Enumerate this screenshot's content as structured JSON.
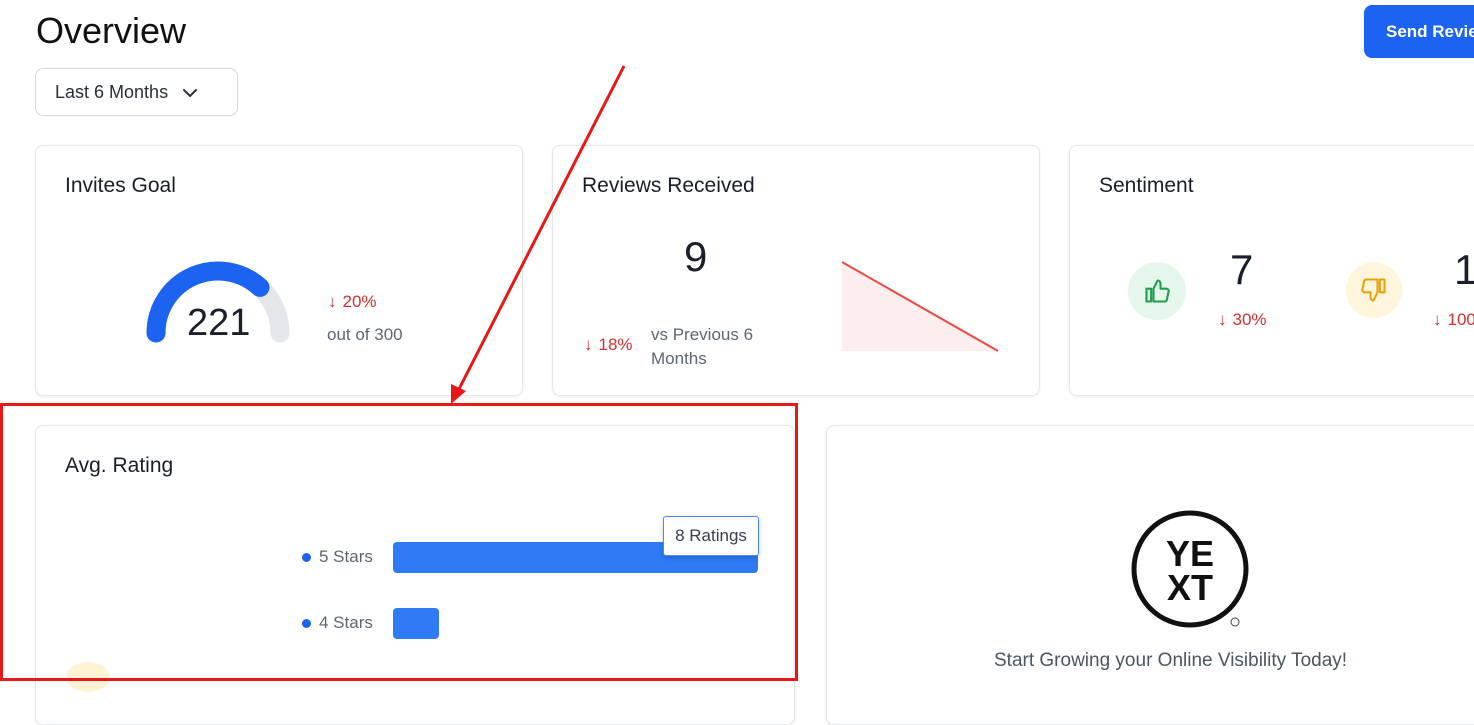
{
  "header": {
    "title": "Overview",
    "send_button_label": "Send Revie"
  },
  "filter": {
    "period_label": "Last 6 Months"
  },
  "invites_goal": {
    "title": "Invites Goal",
    "value": "221",
    "change": "20%",
    "out_of_text": "out of 300",
    "progress_fraction": 0.737
  },
  "reviews_received": {
    "title": "Reviews Received",
    "value": "9",
    "change": "18%",
    "comparison_line1": "vs Previous 6",
    "comparison_line2": "Months"
  },
  "sentiment": {
    "title": "Sentiment",
    "positive_value": "7",
    "positive_change": "30%",
    "negative_value": "1",
    "negative_change": "100"
  },
  "avg_rating": {
    "title": "Avg. Rating",
    "rows": [
      {
        "label": "5 Stars",
        "ratings": 8
      },
      {
        "label": "4 Stars",
        "ratings": 1
      }
    ],
    "tooltip": "8 Ratings"
  },
  "promo": {
    "text": "Start Growing your Online Visibility Today!",
    "logo_top": "YE",
    "logo_bottom": "XT"
  },
  "colors": {
    "accent": "#1b63f0",
    "negative": "#d42f2f",
    "annotation": "#e81818"
  }
}
